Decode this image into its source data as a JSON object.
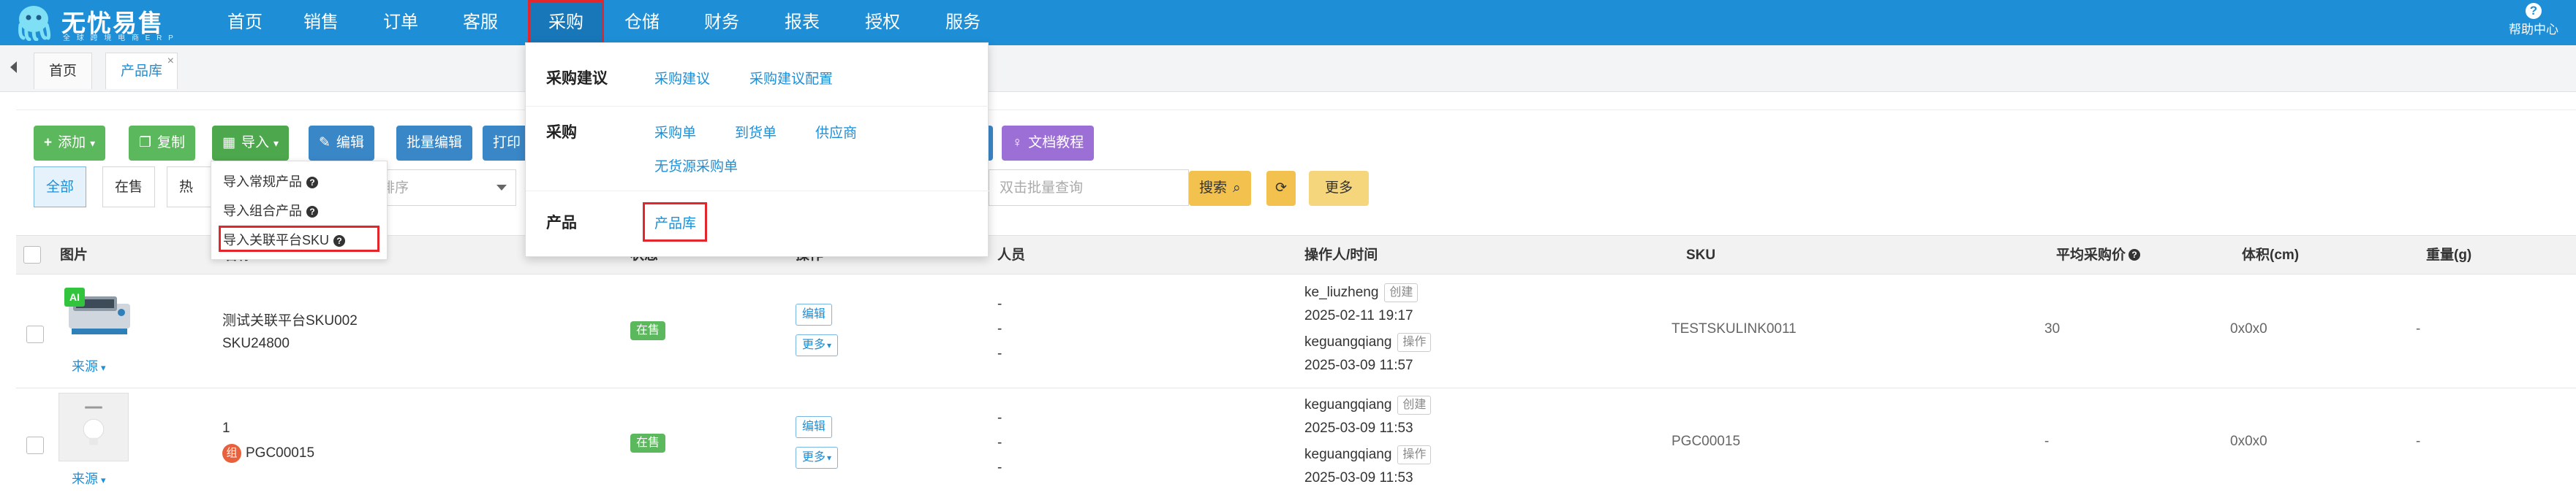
{
  "app": {
    "brand": "无忧易售",
    "brand_sub": "全 球 跨 境 电 商 E R P",
    "help": "帮助中心"
  },
  "nav": {
    "items": [
      {
        "label": "首页"
      },
      {
        "label": "销售"
      },
      {
        "label": "订单"
      },
      {
        "label": "客服"
      },
      {
        "label": "采购",
        "active": true
      },
      {
        "label": "仓储"
      },
      {
        "label": "财务"
      },
      {
        "label": "报表"
      },
      {
        "label": "授权"
      },
      {
        "label": "服务"
      }
    ]
  },
  "tabs": [
    {
      "label": "首页"
    },
    {
      "label": "产品库",
      "active": true,
      "close": "×"
    }
  ],
  "toolbar": {
    "add": "添加",
    "copy": "复制",
    "import": "导入",
    "edit": "编辑",
    "batch_edit": "批量编辑",
    "print": "打印",
    "docs": "文档教程",
    "search": "搜索",
    "more": "更多",
    "refresh_icon": "refresh-icon"
  },
  "filters": {
    "all": "全部",
    "on_sale": "在售",
    "hot": "热销",
    "sort_placeholder": "排序",
    "batch_search_placeholder": "双击批量查询"
  },
  "import_menu": {
    "items": [
      {
        "label": "导入常规产品"
      },
      {
        "label": "导入组合产品"
      },
      {
        "label": "导入关联平台SKU"
      }
    ]
  },
  "mega_menu": {
    "sections": [
      {
        "title": "采购建议",
        "links": [
          "采购建议",
          "采购建议配置"
        ]
      },
      {
        "title": "采购",
        "links": [
          "采购单",
          "到货单",
          "供应商",
          "无货源采购单"
        ]
      },
      {
        "title": "产品",
        "links": [
          "产品库"
        ]
      }
    ]
  },
  "table": {
    "headers": {
      "image": "图片",
      "name": "名称",
      "status": "状态",
      "action": "操作",
      "person": "人员",
      "operator_time": "操作人/时间",
      "sku": "SKU",
      "avg_price": "平均采购价",
      "volume": "体积(cm)",
      "weight": "重量(g)"
    },
    "rows": [
      {
        "source": "来源",
        "ai": "AI",
        "name": "测试关联平台SKU002",
        "sku_code": "SKU24800",
        "status": "在售",
        "edit": "编辑",
        "more": "更多",
        "persons": [
          "-",
          "-",
          "-"
        ],
        "ops": [
          {
            "user": "ke_liuzheng",
            "tag": "创建",
            "time": "2025-02-11 19:17"
          },
          {
            "user": "keguangqiang",
            "tag": "操作",
            "time": "2025-03-09 11:57"
          }
        ],
        "sku": "TESTSKULINK0011",
        "avg_price": "30",
        "volume": "0x0x0",
        "weight": "-"
      },
      {
        "source": "来源",
        "combo": "组",
        "name": "1",
        "sku_code": "PGC00015",
        "status": "在售",
        "edit": "编辑",
        "more": "更多",
        "persons": [
          "-",
          "-",
          "-"
        ],
        "ops": [
          {
            "user": "keguangqiang",
            "tag": "创建",
            "time": "2025-03-09 11:53"
          },
          {
            "user": "keguangqiang",
            "tag": "操作",
            "time": "2025-03-09 11:53"
          }
        ],
        "sku": "PGC00015",
        "avg_price": "-",
        "volume": "0x0x0",
        "weight": "-"
      }
    ]
  },
  "colors": {
    "nav_bg": "#1e8fd6",
    "highlight_red": "#e3262b",
    "green": "#5cb85c",
    "blue_btn": "#3a87c8",
    "purple": "#9b6fd6",
    "yellow": "#f2c14e"
  }
}
